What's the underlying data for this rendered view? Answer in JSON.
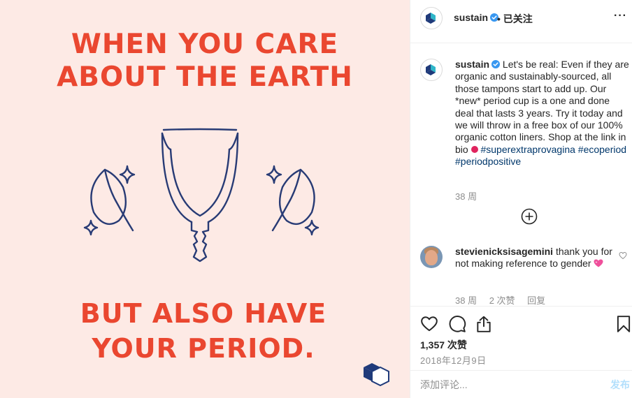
{
  "poster": {
    "headline_top_line1": "WHEN YOU CARE",
    "headline_top_line2": "ABOUT THE EARTH",
    "headline_bottom_line1": "BUT ALSO HAVE",
    "headline_bottom_line2": "YOUR PERIOD.",
    "background_color": "#fdeae5",
    "text_color": "#ea4730",
    "illustration_color": "#283b75"
  },
  "header": {
    "username": "sustain",
    "verified_icon": "verified-badge-icon",
    "follow_status": "• 已关注",
    "more_icon": "more-options-icon",
    "more_label": "···"
  },
  "caption": {
    "username": "sustain",
    "text": "Let's be real: Even if they are organic and sustainably-sourced, all those tampons start to add up. Our *new* period cup is a one and done deal that lasts 3 years. Try it today and we will throw in a free box of our 100% organic cotton liners. Shop at the link in bio",
    "emoji_icon": "round-pushpin-icon",
    "hashtags": "#superextraprovagina #ecoperiod #periodpositive",
    "time": "38 周",
    "load_more_icon": "plus-circle-icon"
  },
  "comments": [
    {
      "username": "stevienicksisagemini",
      "text": "thank you for not making reference to gender",
      "emoji_icon": "sparkling-heart-icon",
      "time": "38 周",
      "likes": "2 次赞",
      "reply_label": "回复"
    }
  ],
  "actions": {
    "like_icon": "heart-icon",
    "comment_icon": "comment-icon",
    "share_icon": "share-icon",
    "save_icon": "bookmark-icon",
    "likes_count": "1,357 次赞",
    "date": "2018年12月9日"
  },
  "add_comment": {
    "placeholder": "添加评论...",
    "post_label": "发布"
  },
  "colors": {
    "brand_blue": "#3897f0",
    "hashtag": "#00376b",
    "muted": "#8e8e8e",
    "post_disabled": "#b2dffc"
  }
}
